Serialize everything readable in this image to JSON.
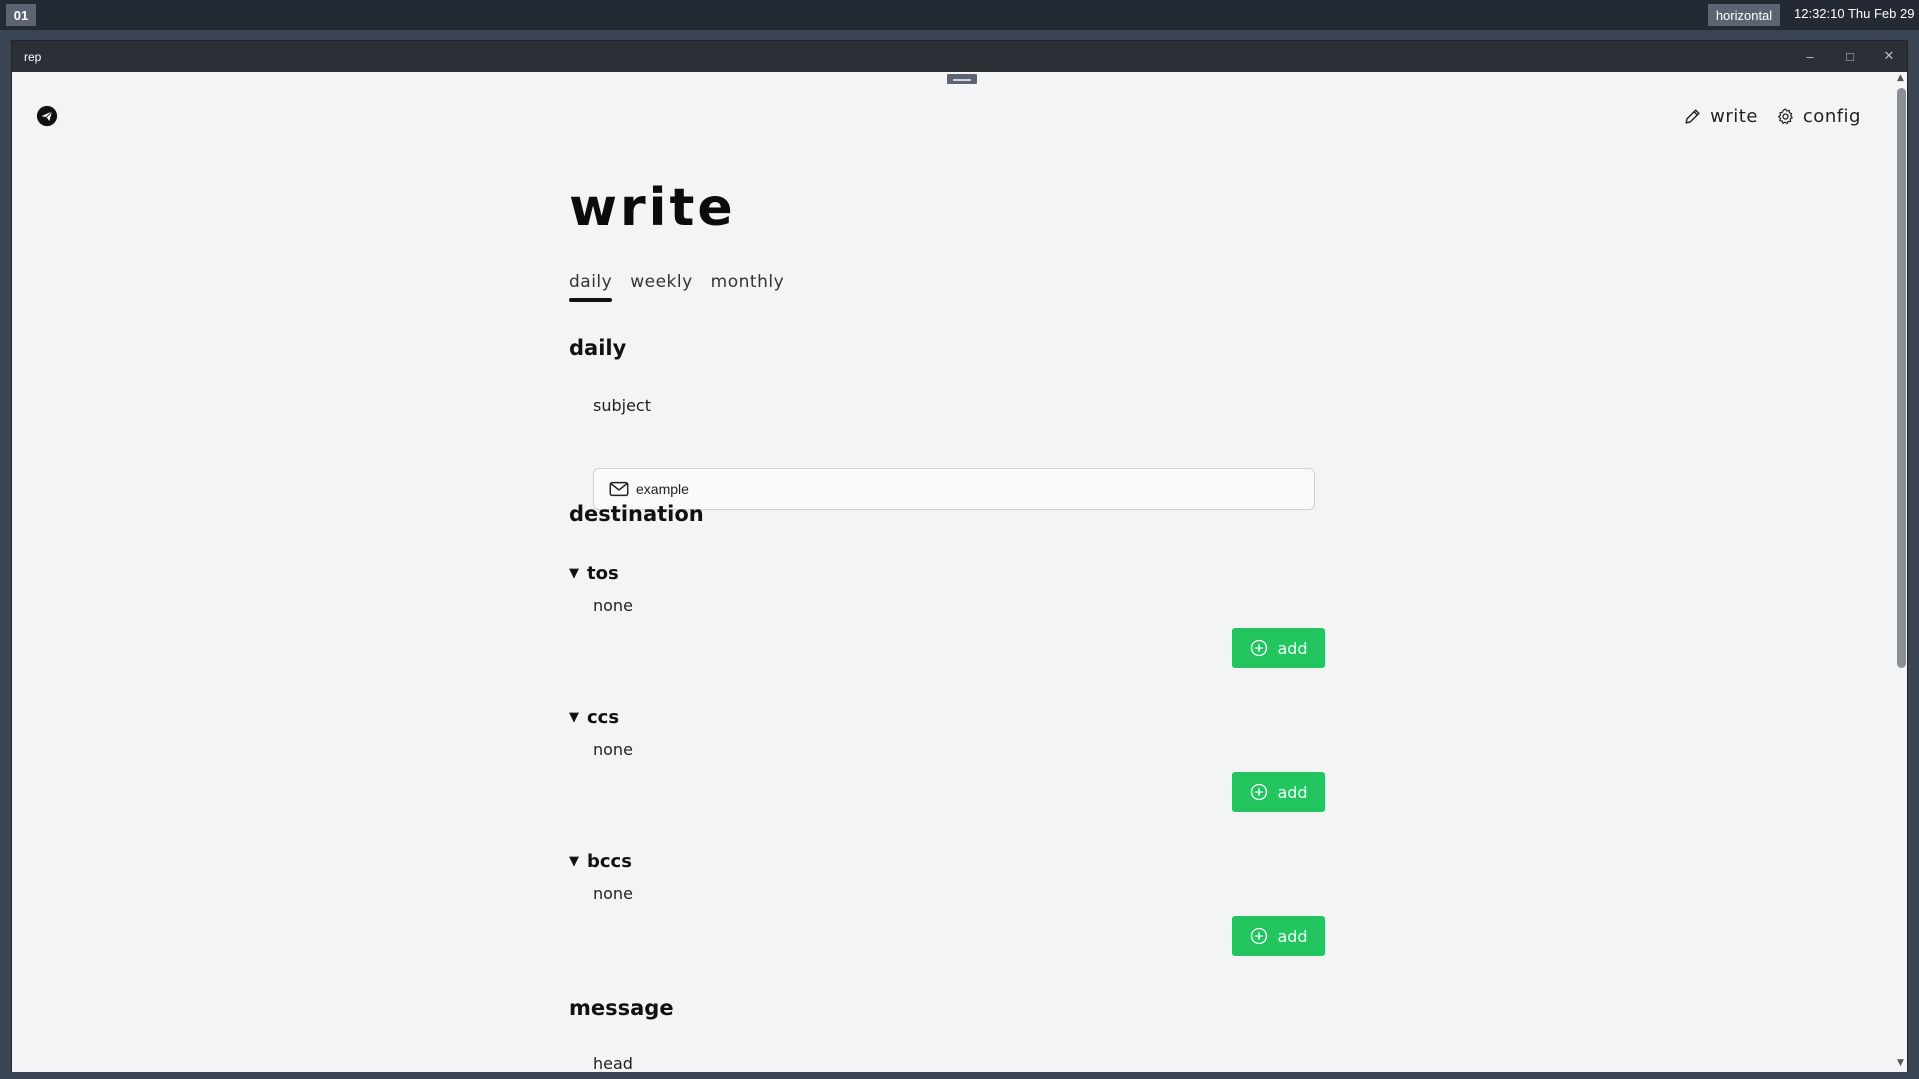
{
  "system": {
    "workspace": "01",
    "layout_mode": "horizontal",
    "clock": "12:32:10 Thu Feb 29"
  },
  "window": {
    "title": "rep"
  },
  "nav": {
    "write_label": "write",
    "config_label": "config"
  },
  "page": {
    "title": "write",
    "tabs": [
      {
        "label": "daily",
        "active": true
      },
      {
        "label": "weekly",
        "active": false
      },
      {
        "label": "monthly",
        "active": false
      }
    ],
    "section_title": "daily",
    "subject": {
      "label": "subject",
      "value": "example"
    },
    "destination": {
      "title": "destination",
      "groups": [
        {
          "label": "tos",
          "status": "none",
          "add_label": "add"
        },
        {
          "label": "ccs",
          "status": "none",
          "add_label": "add"
        },
        {
          "label": "bccs",
          "status": "none",
          "add_label": "add"
        }
      ]
    },
    "message": {
      "title": "message",
      "first_field_label": "head"
    }
  },
  "colors": {
    "accent_green": "#22c55e",
    "background": "#f3f4f6",
    "titlebar": "#2c3036"
  }
}
